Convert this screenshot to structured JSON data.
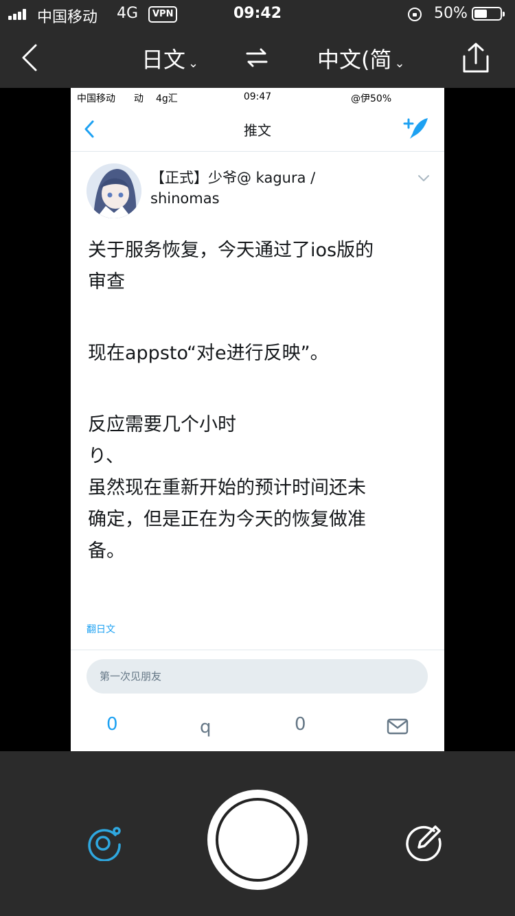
{
  "status_bar": {
    "carrier": "中国移动",
    "network": "4G",
    "vpn": "VPN",
    "time": "09:42",
    "battery": "50%"
  },
  "translate_bar": {
    "source_lang": "日文",
    "target_lang": "中文(简",
    "dropdown_glyph": "⌄"
  },
  "inner": {
    "status_bar": {
      "carrier": "中国移动",
      "extra": "动",
      "network": "4g汇",
      "time": "09:47",
      "right": "@伊50%"
    },
    "nav": {
      "title": "推文"
    },
    "tweet": {
      "name_line1": "【正式】少爷@ kagura /",
      "name_line2": "shinomas",
      "paragraph1_line1": "关于服务恢复，今天通过了ios版的",
      "paragraph1_line2": "审查",
      "paragraph2": "现在appsto“对e进行反映”。",
      "paragraph3_line1": "反应需要几个小时",
      "paragraph3_line2": "り、",
      "paragraph3_line3": "虽然现在重新开始的预计时间还未",
      "paragraph3_line4": "确定，但是正在为今天的恢复做准",
      "paragraph3_line5": "备。",
      "translate_link": "翻日文"
    },
    "reply": {
      "placeholder": "第一次见朋友"
    },
    "actions": {
      "reply_count": "0",
      "retweet_glyph": "q",
      "like_count": "0"
    }
  },
  "colors": {
    "bar": "#2b2b2b",
    "twitter_blue": "#1da1f2",
    "camera_accent": "#2fa8e0"
  },
  "icons": [
    "back-icon",
    "swap-icon",
    "share-icon",
    "compose-icon",
    "mail-icon",
    "camera-switch-icon",
    "edit-icon"
  ]
}
